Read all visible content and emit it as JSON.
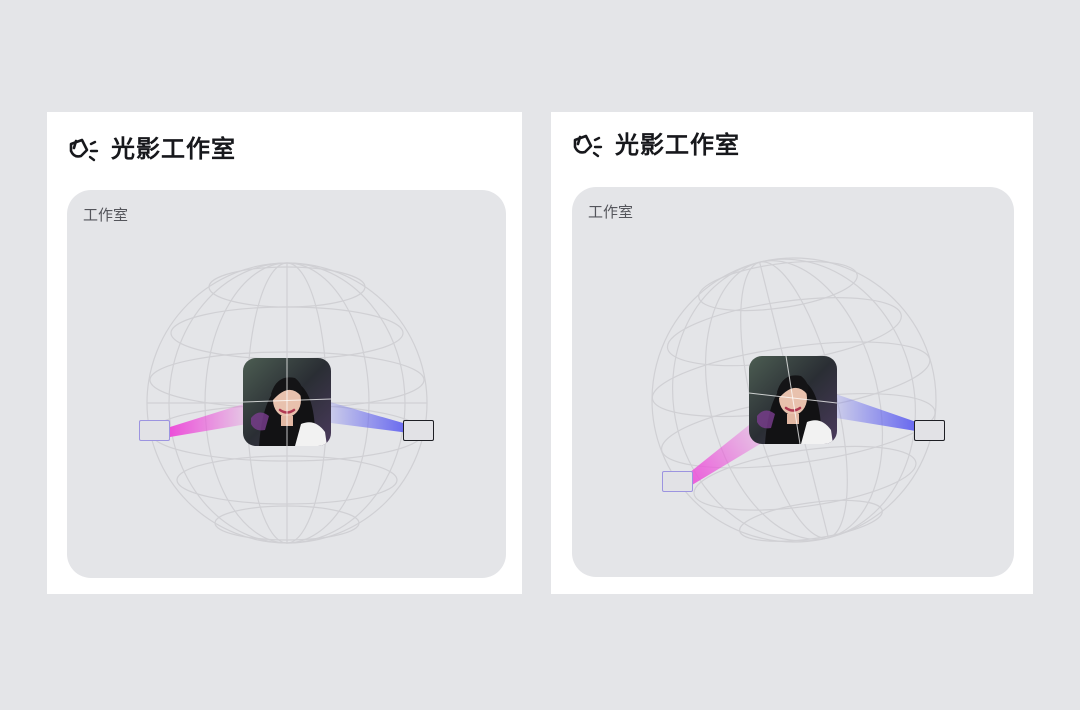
{
  "panels": [
    {
      "id": "left",
      "header": {
        "icon": "spotlight-icon",
        "title": "光影工作室"
      },
      "studio": {
        "label": "工作室",
        "subject": "portrait-photo",
        "lights": [
          {
            "name": "key-light",
            "color": "#ec4fd9",
            "selected": false
          },
          {
            "name": "fill-light",
            "color": "#5a5bf0",
            "selected": true
          }
        ]
      }
    },
    {
      "id": "right",
      "header": {
        "icon": "spotlight-icon",
        "title": "光影工作室"
      },
      "studio": {
        "label": "工作室",
        "subject": "portrait-photo",
        "lights": [
          {
            "name": "key-light",
            "color": "#ec4fd9",
            "selected": false
          },
          {
            "name": "fill-light",
            "color": "#5a5bf0",
            "selected": true
          }
        ]
      }
    }
  ],
  "colors": {
    "page_background": "#e4e5e8",
    "panel_background": "#ffffff",
    "card_background": "#e4e5e8",
    "title_text": "#17181c",
    "label_text": "#54555b",
    "sphere_wireframe": "#d0d0d4",
    "magenta_beam": "#ec4fd9",
    "blue_beam": "#5a5bf0"
  }
}
